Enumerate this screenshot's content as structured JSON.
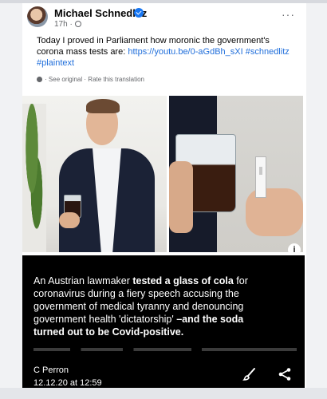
{
  "post": {
    "author": "Michael Schnedlitz",
    "time": "17h ·",
    "more": "···",
    "text_lines": [
      "Today I proved in Parliament how moronic the government's",
      "corona mass tests are:",
      "#plaintext"
    ],
    "link": "https://youtu.be/0-aGdBh_sXI",
    "hashtag_1": "#schnedlitz",
    "see_original": "See original",
    "rate_translation": "Rate this translation",
    "separator": "·"
  },
  "overlay": {
    "info": "i",
    "caption": {
      "l1a": "An Austrian lawmaker ",
      "l1b": "tested a glass of cola",
      "l1c": " for",
      "l2": "coronavirus during a fiery speech accusing the",
      "l3": "government of medical tyranny and denouncing",
      "l4a": "government health 'dictatorship' ",
      "l4b": "–and the soda",
      "l5": "turned out to be Covid-positive."
    },
    "credit_name": "C Perron",
    "credit_date": "12.12.20 at 12:59"
  },
  "colors": {
    "link": "#216fdb",
    "verified": "#1877f2",
    "caption_bg": "#000000"
  },
  "icons": [
    "verified-icon",
    "globe-icon",
    "more-icon",
    "gear-icon",
    "info-icon",
    "brush-icon",
    "share-icon"
  ]
}
